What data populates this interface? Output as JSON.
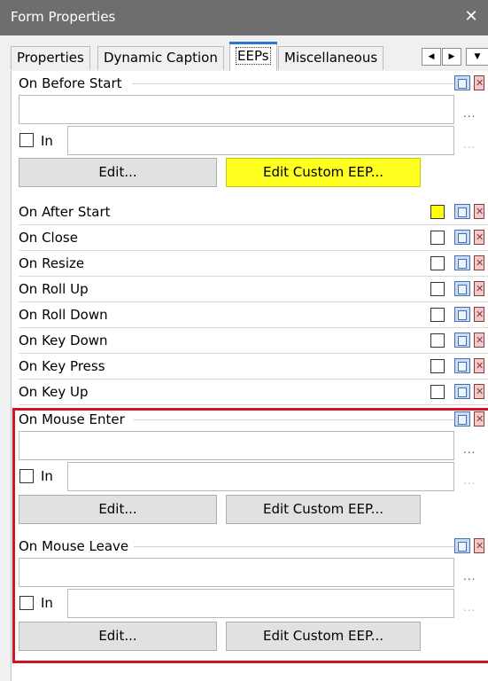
{
  "window": {
    "title": "Form Properties",
    "close_glyph": "✕"
  },
  "tabs": [
    {
      "label": "Properties",
      "active": false
    },
    {
      "label": "Dynamic Caption",
      "active": false
    },
    {
      "label": "EEPs",
      "active": true
    },
    {
      "label": "Miscellaneous",
      "active": false
    }
  ],
  "tab_scroll": {
    "left": "◀",
    "right": "▶",
    "menu": "▼"
  },
  "sections": {
    "before_start": {
      "title": "On Before Start",
      "value": "",
      "in_label": "In",
      "in_value": "",
      "edit_label": "Edit...",
      "custom_label": "Edit Custom EEP...",
      "custom_highlighted": true
    },
    "mouse_enter": {
      "title": "On Mouse Enter",
      "value": "",
      "in_label": "In",
      "in_value": "",
      "edit_label": "Edit...",
      "custom_label": "Edit Custom EEP..."
    },
    "mouse_leave": {
      "title": "On Mouse Leave",
      "value": "",
      "in_label": "In",
      "in_value": "",
      "edit_label": "Edit...",
      "custom_label": "Edit Custom EEP..."
    }
  },
  "events": [
    {
      "label": "On After Start",
      "has_custom": true
    },
    {
      "label": "On Close",
      "has_custom": false
    },
    {
      "label": "On Resize",
      "has_custom": false
    },
    {
      "label": "On Roll Up",
      "has_custom": false
    },
    {
      "label": "On Roll Down",
      "has_custom": false
    },
    {
      "label": "On Key Down",
      "has_custom": false
    },
    {
      "label": "On Key Press",
      "has_custom": false
    },
    {
      "label": "On Key Up",
      "has_custom": false
    }
  ],
  "ellipsis": "...",
  "colors": {
    "highlight_border": "#d1131f",
    "custom_eep_yellow": "#ffff22",
    "active_tab_accent": "#2b77d6"
  }
}
